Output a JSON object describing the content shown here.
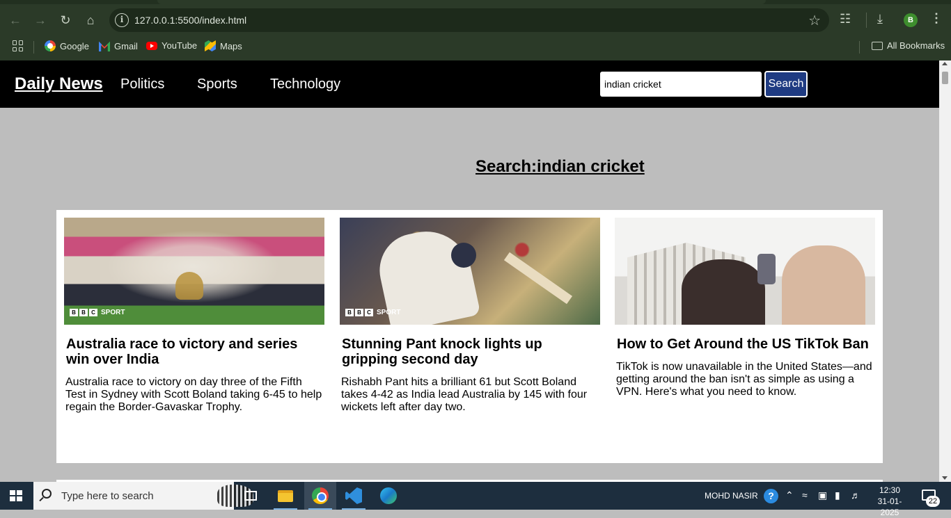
{
  "browser": {
    "url": "127.0.0.1:5500/index.html",
    "profile_initial": "B",
    "bookmarks": [
      {
        "label": "Google",
        "icon": "google-icon"
      },
      {
        "label": "Gmail",
        "icon": "gmail-icon"
      },
      {
        "label": "YouTube",
        "icon": "youtube-icon"
      },
      {
        "label": "Maps",
        "icon": "maps-icon"
      }
    ],
    "all_bookmarks_label": "All Bookmarks"
  },
  "site": {
    "brand": "Daily News",
    "nav": [
      "Politics",
      "Sports",
      "Technology"
    ],
    "search": {
      "value": "indian cricket",
      "button_label": "Search"
    },
    "heading": "Search:indian cricket",
    "colors": {
      "nav_bg": "#000000",
      "page_bg": "#bdbdbd",
      "search_button": "#1f3b82"
    }
  },
  "articles": [
    {
      "title": "Australia race to victory and series win over India",
      "description": "Australia race to victory on day three of the Fifth Test in Sydney with Scott Boland taking 6-45 to help regain the Border-Gavaskar Trophy.",
      "image_badge": "SPORT"
    },
    {
      "title": "Stunning Pant knock lights up gripping second day",
      "description": "Rishabh Pant hits a brilliant 61 but Scott Boland takes 4-42 as India lead Australia by 145 with four wickets left after day two.",
      "image_badge": "SPORT"
    },
    {
      "title": "How to Get Around the US TikTok Ban",
      "description": "TikTok is now unavailable in the United States—and getting around the ban isn't as simple as using a VPN. Here's what you need to know.",
      "image_badge": ""
    }
  ],
  "taskbar": {
    "search_placeholder": "Type here to search",
    "user": "MOHD NASIR",
    "time": "12:30",
    "date": "31-01-2025",
    "notification_count": "22"
  }
}
